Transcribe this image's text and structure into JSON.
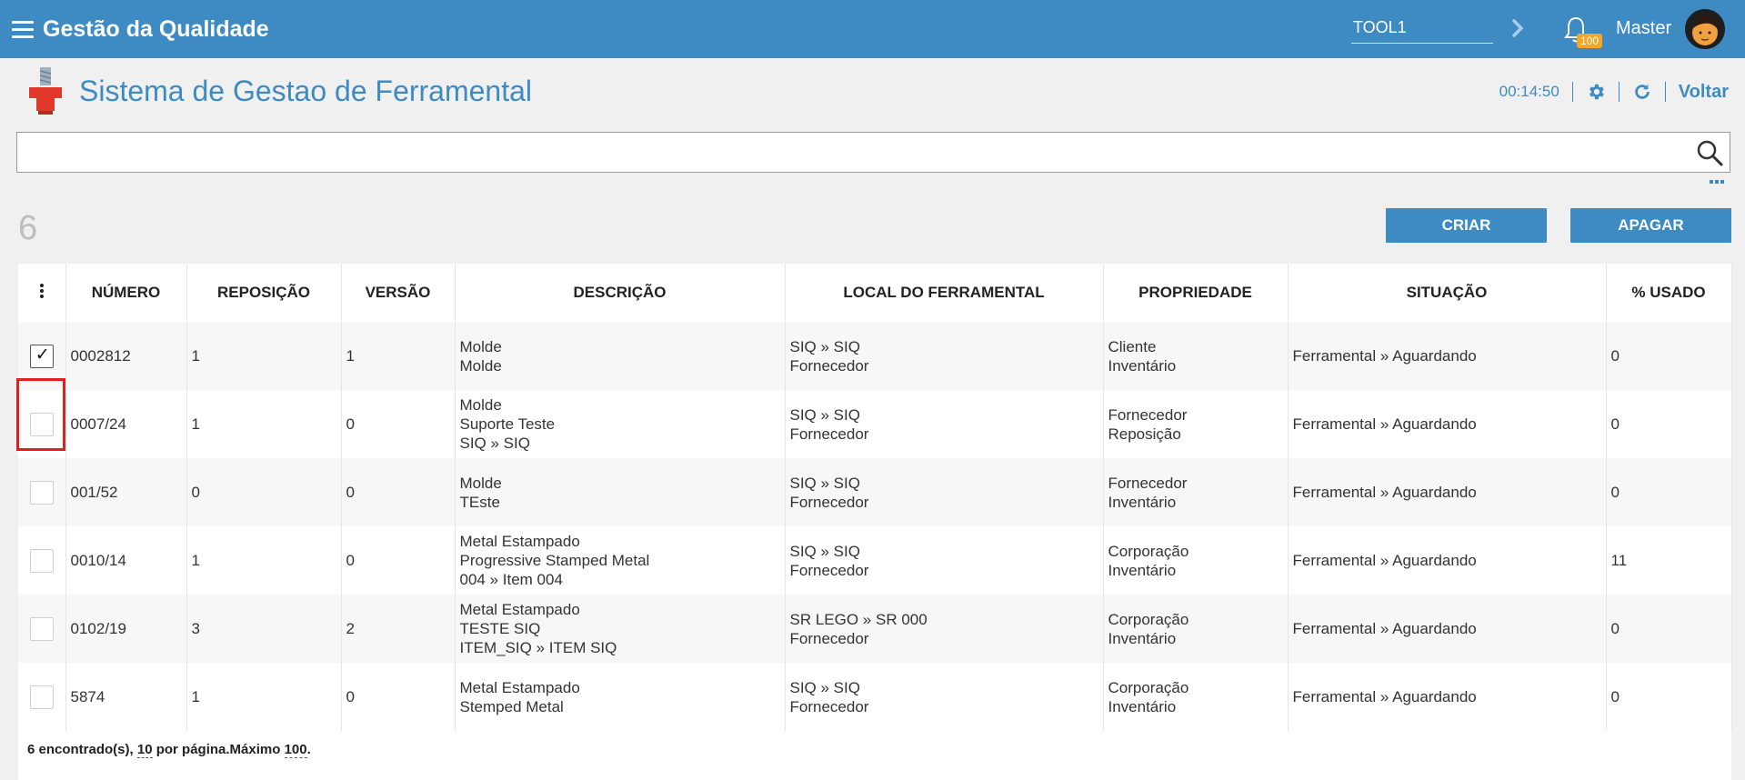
{
  "app": {
    "title": "Gestão da Qualidade"
  },
  "topbar": {
    "company_value": "TOOL1",
    "notifications_count": "100",
    "user_name": "Master"
  },
  "header": {
    "title": "Sistema de Gestao de Ferramental",
    "timer": "00:14:50",
    "back_label": "Voltar"
  },
  "search": {
    "value": "",
    "placeholder": ""
  },
  "record_count": "6",
  "actions": {
    "create_label": "CRIAR",
    "delete_label": "APAGAR"
  },
  "table": {
    "columns": [
      "NÚMERO",
      "REPOSIÇÃO",
      "VERSÃO",
      "DESCRIÇÃO",
      "LOCAL DO FERRAMENTAL",
      "PROPRIEDADE",
      "SITUAÇÃO",
      "% USADO"
    ],
    "rows": [
      {
        "checked": true,
        "numero": "0002812",
        "reposicao": "1",
        "versao": "1",
        "descricao": [
          "Molde",
          "Molde"
        ],
        "local": [
          "SIQ » SIQ",
          "Fornecedor"
        ],
        "propriedade": [
          "Cliente",
          "Inventário"
        ],
        "situacao": "Ferramental » Aguardando",
        "usado": "0"
      },
      {
        "checked": false,
        "numero": "0007/24",
        "reposicao": "1",
        "versao": "0",
        "descricao": [
          "Molde",
          "Suporte Teste",
          "SIQ » SIQ"
        ],
        "local": [
          "SIQ » SIQ",
          "Fornecedor"
        ],
        "propriedade": [
          "Fornecedor",
          "Reposição"
        ],
        "situacao": "Ferramental » Aguardando",
        "usado": "0"
      },
      {
        "checked": false,
        "numero": "001/52",
        "reposicao": "0",
        "versao": "0",
        "descricao": [
          "Molde",
          "TEste"
        ],
        "local": [
          "SIQ » SIQ",
          "Fornecedor"
        ],
        "propriedade": [
          "Fornecedor",
          "Inventário"
        ],
        "situacao": "Ferramental » Aguardando",
        "usado": "0"
      },
      {
        "checked": false,
        "numero": "0010/14",
        "reposicao": "1",
        "versao": "0",
        "descricao": [
          "Metal Estampado",
          "Progressive Stamped Metal",
          "004 » Item 004"
        ],
        "local": [
          "SIQ » SIQ",
          "Fornecedor"
        ],
        "propriedade": [
          "Corporação",
          "Inventário"
        ],
        "situacao": "Ferramental » Aguardando",
        "usado": "11"
      },
      {
        "checked": false,
        "numero": "0102/19",
        "reposicao": "3",
        "versao": "2",
        "descricao": [
          "Metal Estampado",
          "TESTE SIQ",
          "ITEM_SIQ » ITEM SIQ"
        ],
        "local": [
          "SR LEGO » SR 000",
          "Fornecedor"
        ],
        "propriedade": [
          "Corporação",
          "Inventário"
        ],
        "situacao": "Ferramental » Aguardando",
        "usado": "0"
      },
      {
        "checked": false,
        "numero": "5874",
        "reposicao": "1",
        "versao": "0",
        "descricao": [
          "Metal Estampado",
          "Stemped Metal"
        ],
        "local": [
          "SIQ » SIQ",
          "Fornecedor"
        ],
        "propriedade": [
          "Corporação",
          "Inventário"
        ],
        "situacao": "Ferramental » Aguardando",
        "usado": "0"
      }
    ]
  },
  "footer": {
    "found_text": "6 encontrado(s), ",
    "per_page": "10",
    "per_page_text": " por página.Máximo ",
    "max": "100",
    "end": "."
  },
  "colors": {
    "primary": "#3d8bc2",
    "highlight": "#e02020",
    "badge": "#f5a623"
  },
  "icons": [
    "hamburger-icon",
    "chevron-right-icon",
    "bell-icon",
    "user-avatar",
    "module-tool-icon",
    "gear-icon",
    "refresh-icon",
    "search-icon",
    "more-dots-icon",
    "kebab-menu-icon",
    "checkbox"
  ]
}
